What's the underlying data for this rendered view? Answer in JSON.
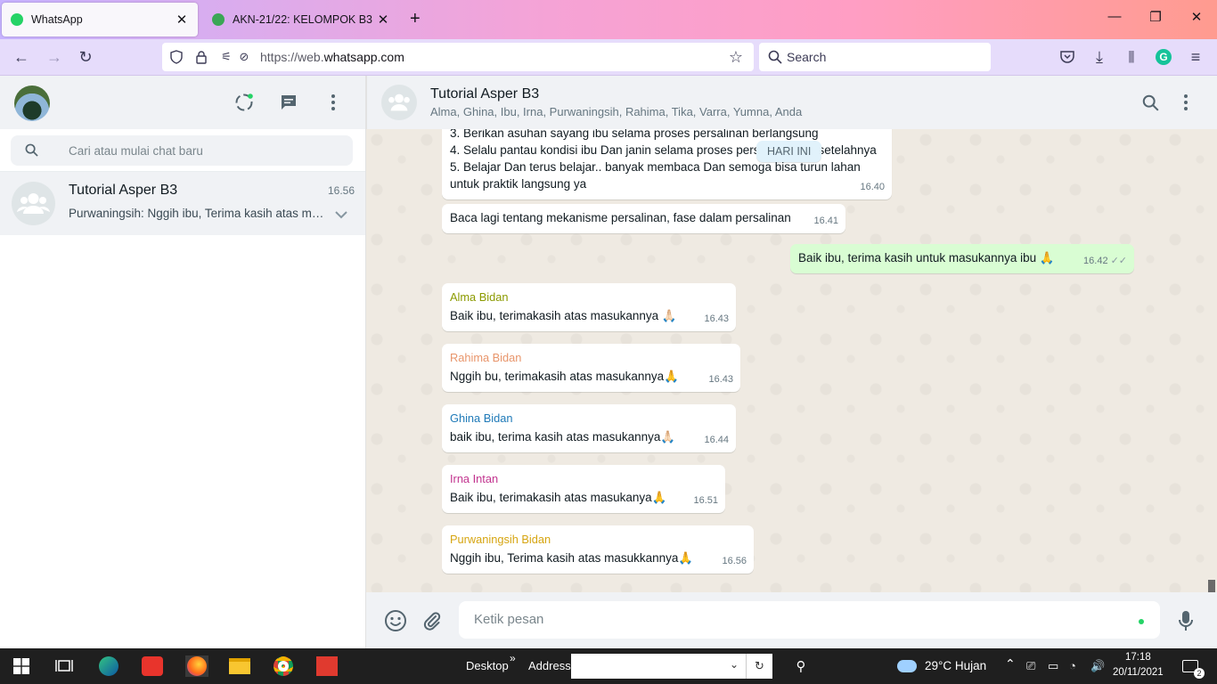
{
  "browser": {
    "tabs": [
      {
        "title": "WhatsApp",
        "active": true
      },
      {
        "title": "AKN-21/22: KELOMPOK B3",
        "active": false
      }
    ],
    "url_prefix": "https://web.",
    "url_domain": "whatsapp.com",
    "search_placeholder": "Search"
  },
  "sidebar": {
    "search_placeholder": "Cari atau mulai chat baru",
    "chats": [
      {
        "name": "Tutorial Asper B3",
        "time": "16.56",
        "last_message": "Purwaningsih: Nggih ibu, Terima kasih atas masukkannya 🙏"
      }
    ]
  },
  "chat": {
    "title": "Tutorial Asper B3",
    "members": "Alma, Ghina, Ibu, Irna, Purwaningsih, Rahima, Tika, Varra, Yumna, Anda",
    "date_chip": "HARI INI",
    "messages": [
      {
        "id": "m1",
        "direction": "in",
        "lines": [
          "3. Berikan asuhan sayang ibu selama proses persalinan berlangsung",
          "4. Selalu pantau kondisi ibu Dan janin selama proses persalinan dan setelahnya",
          "5. Belajar Dan terus belajar.. banyak membaca Dan semoga bisa turun lahan",
          "untuk praktik langsung ya"
        ],
        "time": "16.40"
      },
      {
        "id": "m2",
        "direction": "in",
        "text": "Baca lagi tentang mekanisme persalinan, fase dalam persalinan",
        "time": "16.41"
      },
      {
        "id": "m3",
        "direction": "out",
        "text": "Baik ibu, terima kasih untuk masukannya ibu 🙏",
        "time": "16.42",
        "read": true
      },
      {
        "id": "m4",
        "direction": "in",
        "sender": "Alma Bidan",
        "sender_color": "#8b9a00",
        "text": "Baik ibu, terimakasih atas masukannya 🙏🏻",
        "time": "16.43"
      },
      {
        "id": "m5",
        "direction": "in",
        "sender": "Rahima Bidan",
        "sender_color": "#e8956b",
        "text": "Nggih bu, terimakasih atas masukannya🙏",
        "time": "16.43"
      },
      {
        "id": "m6",
        "direction": "in",
        "sender": "Ghina Bidan",
        "sender_color": "#1f7ab8",
        "text": "baik ibu, terima kasih atas masukannya🙏🏻",
        "time": "16.44"
      },
      {
        "id": "m7",
        "direction": "in",
        "sender": "Irna Intan",
        "sender_color": "#c2348f",
        "text": "Baik ibu, terimakasih atas masukanya🙏",
        "time": "16.51"
      },
      {
        "id": "m8",
        "direction": "in",
        "sender": "Purwaningsih Bidan",
        "sender_color": "#d6a511",
        "text": "Nggih ibu, Terima kasih atas masukkannya🙏",
        "time": "16.56"
      }
    ],
    "composer_placeholder": "Ketik pesan"
  },
  "taskbar": {
    "desktop_label": "Desktop",
    "address_label": "Address",
    "weather": "29°C  Hujan",
    "time": "17:18",
    "date": "20/11/2021",
    "notification_count": "2"
  }
}
